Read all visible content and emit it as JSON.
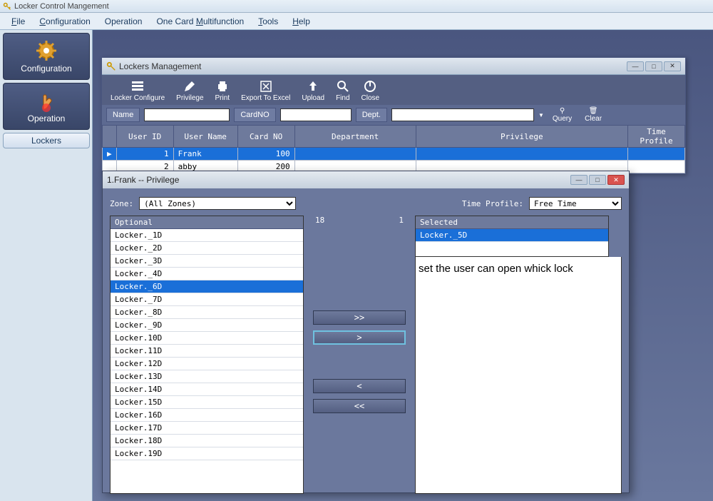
{
  "app": {
    "title": "Locker Control Mangement"
  },
  "menu": {
    "file": "File",
    "configuration": "Configuration",
    "operation": "Operation",
    "onecard": "One Card Multifunction",
    "tools": "Tools",
    "help": "Help"
  },
  "sidebar": {
    "configuration": "Configuration",
    "operation": "Operation",
    "lockers": "Lockers"
  },
  "child": {
    "title": "Lockers  Management",
    "toolbar": {
      "configure": "Locker Configure",
      "privilege": "Privilege",
      "print": "Print",
      "export": "Export To Excel",
      "upload": "Upload",
      "find": "Find",
      "close": "Close"
    },
    "search": {
      "name_label": "Name",
      "cardno_label": "CardNO",
      "dept_label": "Dept.",
      "query": "Query",
      "clear": "Clear"
    },
    "columns": {
      "userid": "User ID",
      "username": "User Name",
      "cardno": "Card NO",
      "dept": "Department",
      "privilege": "Privilege",
      "timeprofile": "Time Profile"
    },
    "rows": [
      {
        "userid": "1",
        "username": "Frank",
        "cardno": "100",
        "dept": "",
        "privilege": "",
        "timeprofile": ""
      },
      {
        "userid": "2",
        "username": "abby",
        "cardno": "200",
        "dept": "",
        "privilege": "",
        "timeprofile": ""
      }
    ]
  },
  "dialog": {
    "title": "1.Frank -- Privilege",
    "zone_label": "Zone:",
    "zone_value": "(All Zones)",
    "tp_label": "Time Profile:",
    "tp_value": "Free Time",
    "left_header": "Optional",
    "right_header": "Selected",
    "count_left": "18",
    "count_right": "1",
    "optional": [
      "Locker._1D",
      "Locker._2D",
      "Locker._3D",
      "Locker._4D",
      "Locker._6D",
      "Locker._7D",
      "Locker._8D",
      "Locker._9D",
      "Locker.10D",
      "Locker.11D",
      "Locker.12D",
      "Locker.13D",
      "Locker.14D",
      "Locker.15D",
      "Locker.16D",
      "Locker.17D",
      "Locker.18D",
      "Locker.19D"
    ],
    "optional_selected_index": 4,
    "selected": [
      "Locker._5D"
    ],
    "buttons": {
      "add_all": ">>",
      "add": ">",
      "remove": "<",
      "remove_all": "<<"
    },
    "annotation": "set the user can open whick lock"
  }
}
